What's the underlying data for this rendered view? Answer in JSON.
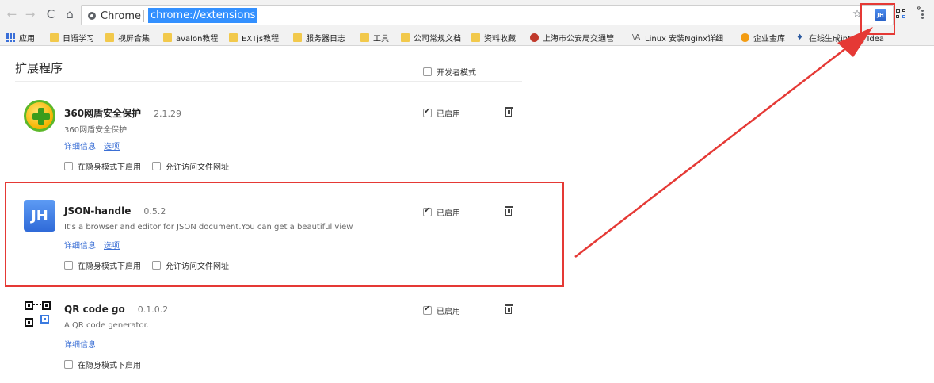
{
  "toolbar": {
    "site_label": "Chrome",
    "url": "chrome://extensions",
    "jh_badge": "JH"
  },
  "bookmarks": {
    "items": [
      {
        "label": "应用",
        "kind": "apps"
      },
      {
        "label": "日语学习",
        "kind": "folder"
      },
      {
        "label": "视屏合集",
        "kind": "folder"
      },
      {
        "label": "avalon教程",
        "kind": "folder"
      },
      {
        "label": "EXTjs教程",
        "kind": "folder"
      },
      {
        "label": "服务器日志",
        "kind": "folder"
      },
      {
        "label": "工具",
        "kind": "folder"
      },
      {
        "label": "公司常规文档",
        "kind": "folder"
      },
      {
        "label": "资料收藏",
        "kind": "folder"
      },
      {
        "label": "上海市公安局交通管",
        "kind": "favicon",
        "color": "#c0392b"
      },
      {
        "label": "Linux 安装Nginx详细",
        "kind": "glyph",
        "glyph": "\\A",
        "color": "#555555"
      },
      {
        "label": "企业金库",
        "kind": "favicon",
        "color": "#f39c12"
      },
      {
        "label": "在线生成intellij Idea",
        "kind": "glyph",
        "glyph": "♦",
        "color": "#2c5aa0"
      }
    ],
    "more": "»"
  },
  "page": {
    "title": "扩展程序",
    "dev_mode_label": "开发者模式"
  },
  "extensions": [
    {
      "name": "360网盾安全保护",
      "version": "2.1.29",
      "description": "360网盾安全保护",
      "links": [
        "详细信息",
        "选项"
      ],
      "options": [
        "在隐身模式下启用",
        "允许访问文件网址"
      ],
      "enabled_label": "已启用",
      "icon": "360-shield-icon"
    },
    {
      "name": "JSON-handle",
      "version": "0.5.2",
      "description": "It's a browser and editor for JSON document.You can get a beautiful view",
      "links": [
        "详细信息",
        "选项"
      ],
      "options": [
        "在隐身模式下启用",
        "允许访问文件网址"
      ],
      "enabled_label": "已启用",
      "icon_text": "JH"
    },
    {
      "name": "QR code go",
      "version": "0.1.0.2",
      "description": "A QR code generator.",
      "links": [
        "详细信息"
      ],
      "options": [
        "在隐身模式下启用"
      ],
      "enabled_label": "已启用",
      "icon": "qr-code-icon"
    }
  ],
  "colors": {
    "annotation": "#e53935",
    "link": "#3b6fd5",
    "url_highlight": "#3390ff"
  }
}
